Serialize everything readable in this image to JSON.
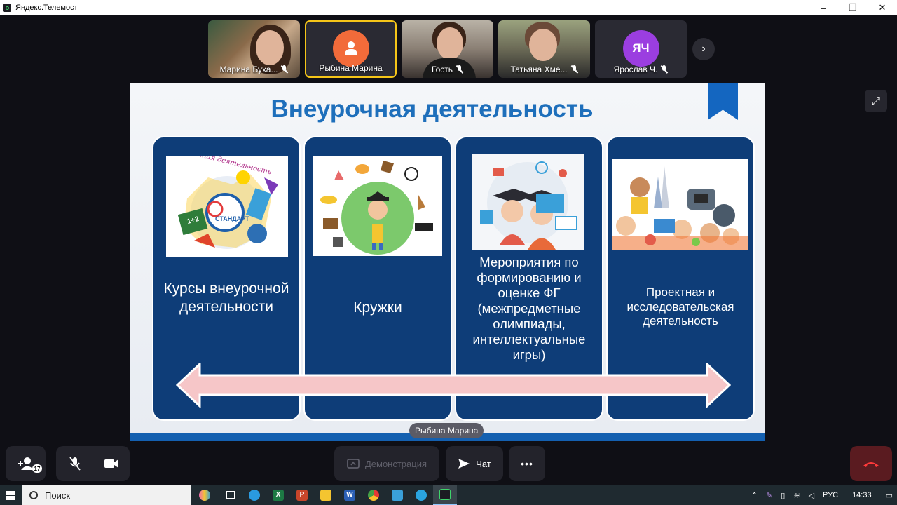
{
  "window": {
    "title": "Яндекс.Телемост",
    "controls": [
      "–",
      "❐",
      "✕"
    ]
  },
  "participants": [
    {
      "name": "Марина Буха...",
      "muted": true,
      "type": "video"
    },
    {
      "name": "Рыбина Марина",
      "muted": false,
      "type": "avatar-icon",
      "active": true
    },
    {
      "name": "Гость",
      "muted": true,
      "type": "video"
    },
    {
      "name": "Татьяна Хме...",
      "muted": true,
      "type": "video"
    },
    {
      "name": "Ярослав Ч.",
      "muted": true,
      "type": "initials",
      "initials": "ЯЧ"
    }
  ],
  "slide": {
    "title": "Внеурочная деятельность",
    "cards": [
      {
        "text": "Курсы внеурочной деятельности",
        "image": "stamp-standart-illustration",
        "image_text": [
          "Внеурочная деятельность",
          "СТАНДАРТ",
          "1+2"
        ]
      },
      {
        "text": "Кружки",
        "image": "boy-with-hobbies-illustration"
      },
      {
        "text": "Мероприятия по формированию и оценке ФГ (межпредметные олимпиады, интеллектуальные игры)",
        "image": "graduates-science-illustration"
      },
      {
        "text": "Проектная и исследовательская деятельность",
        "image": "kids-robots-rocket-illustration"
      }
    ]
  },
  "speaker_label": "Рыбина Марина",
  "controls": {
    "invite_count": "17",
    "screen_share": "Демонстрация",
    "chat": "Чат",
    "more": "•••"
  },
  "taskbar": {
    "search_placeholder": "Поиск",
    "lang": "РУС",
    "time": "14:33"
  },
  "colors": {
    "accent_active": "#f5c518",
    "slide_title": "#1e6fbb",
    "card_bg": "#0e3d78",
    "arrow_fill": "#f6c6c8",
    "end_call": "#e0262f"
  }
}
